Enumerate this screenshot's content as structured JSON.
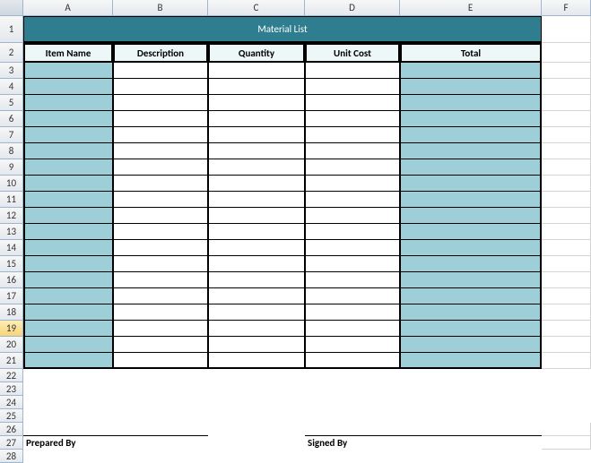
{
  "columns": [
    "A",
    "B",
    "C",
    "D",
    "E",
    "F"
  ],
  "title": "Material List",
  "headers": {
    "item_name": "Item Name",
    "description": "Description",
    "quantity": "Quantity",
    "unit_cost": "Unit Cost",
    "total": "Total"
  },
  "rows": [
    {
      "item": "",
      "desc": "",
      "qty": "",
      "cost": "",
      "total": ""
    },
    {
      "item": "",
      "desc": "",
      "qty": "",
      "cost": "",
      "total": ""
    },
    {
      "item": "",
      "desc": "",
      "qty": "",
      "cost": "",
      "total": ""
    },
    {
      "item": "",
      "desc": "",
      "qty": "",
      "cost": "",
      "total": ""
    },
    {
      "item": "",
      "desc": "",
      "qty": "",
      "cost": "",
      "total": ""
    },
    {
      "item": "",
      "desc": "",
      "qty": "",
      "cost": "",
      "total": ""
    },
    {
      "item": "",
      "desc": "",
      "qty": "",
      "cost": "",
      "total": ""
    },
    {
      "item": "",
      "desc": "",
      "qty": "",
      "cost": "",
      "total": ""
    },
    {
      "item": "",
      "desc": "",
      "qty": "",
      "cost": "",
      "total": ""
    },
    {
      "item": "",
      "desc": "",
      "qty": "",
      "cost": "",
      "total": ""
    },
    {
      "item": "",
      "desc": "",
      "qty": "",
      "cost": "",
      "total": ""
    },
    {
      "item": "",
      "desc": "",
      "qty": "",
      "cost": "",
      "total": ""
    },
    {
      "item": "",
      "desc": "",
      "qty": "",
      "cost": "",
      "total": ""
    },
    {
      "item": "",
      "desc": "",
      "qty": "",
      "cost": "",
      "total": ""
    },
    {
      "item": "",
      "desc": "",
      "qty": "",
      "cost": "",
      "total": ""
    },
    {
      "item": "",
      "desc": "",
      "qty": "",
      "cost": "",
      "total": ""
    },
    {
      "item": "",
      "desc": "",
      "qty": "",
      "cost": "",
      "total": ""
    },
    {
      "item": "",
      "desc": "",
      "qty": "",
      "cost": "",
      "total": ""
    },
    {
      "item": "",
      "desc": "",
      "qty": "",
      "cost": "",
      "total": ""
    }
  ],
  "signatures": {
    "prepared_by": "Prepared By",
    "signed_by": "Signed By"
  },
  "selected_row": 19
}
